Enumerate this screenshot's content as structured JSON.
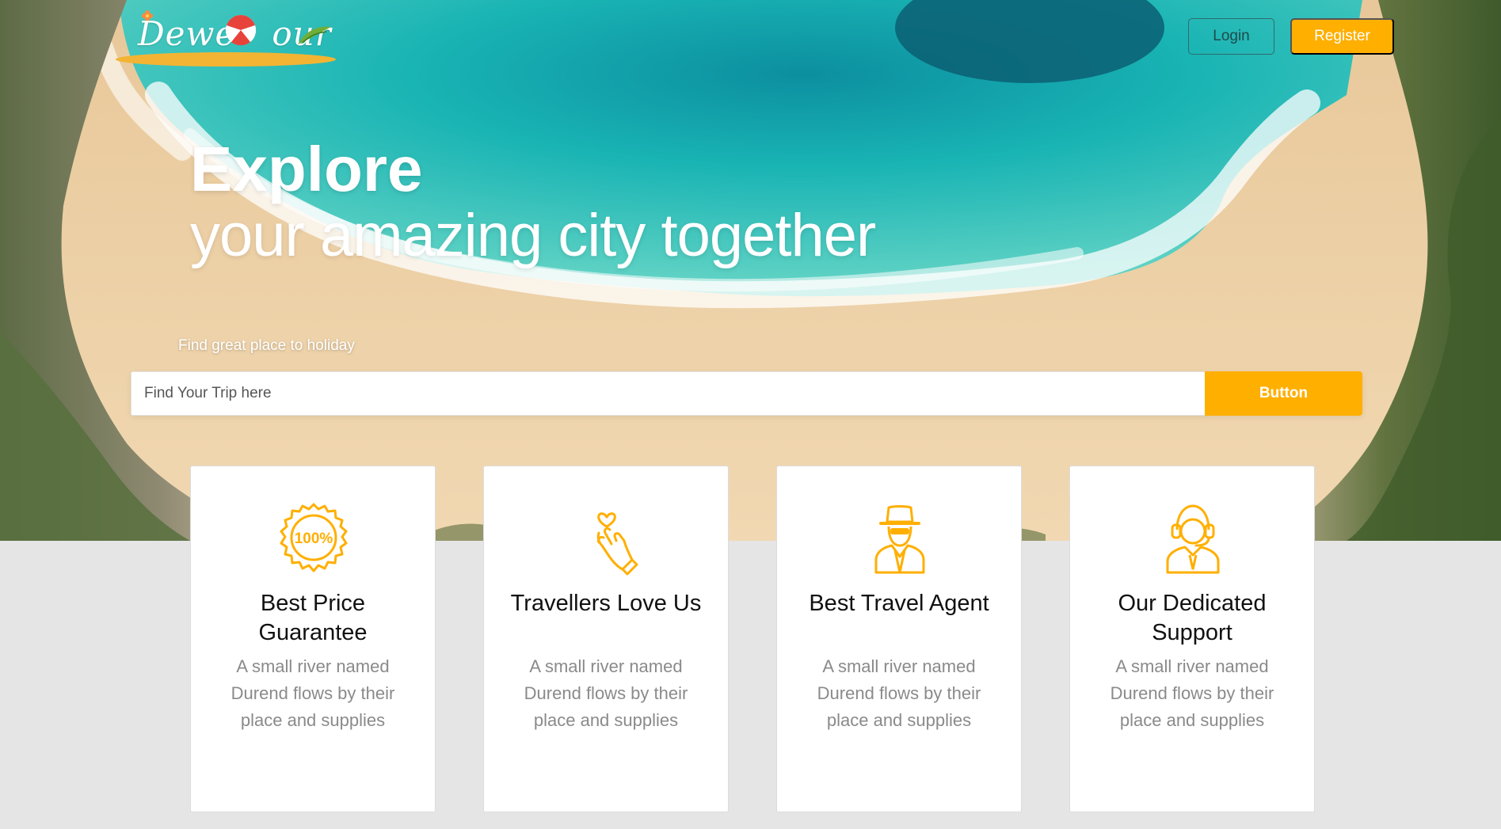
{
  "brand": {
    "logo_text_left": "Dewe",
    "logo_text_right": "our"
  },
  "nav": {
    "login_label": "Login",
    "register_label": "Register"
  },
  "hero": {
    "title": "Explore",
    "subtitle": "your amazing city together",
    "search_label": "Find great place to holiday",
    "search_placeholder": "Find Your Trip here",
    "search_button_label": "Button"
  },
  "features": [
    {
      "icon": "hundred-percent-badge-icon",
      "title": "Best Price Guarantee",
      "description": "A small river named Durend flows by their place and supplies"
    },
    {
      "icon": "finger-heart-icon",
      "title": "Travellers Love Us",
      "description": "A small river named Durend flows by their place and supplies"
    },
    {
      "icon": "travel-agent-icon",
      "title": "Best Travel Agent",
      "description": "A small river named Durend flows by their place and supplies"
    },
    {
      "icon": "support-agent-icon",
      "title": "Our Dedicated Support",
      "description": "A small river named Durend flows by their place and supplies"
    }
  ],
  "colors": {
    "accent": "#ffaf00",
    "page_background": "#e5e5e5",
    "card_text": "#111111",
    "card_muted_text": "#8a8a8a",
    "login_border": "#2f6b6b"
  }
}
